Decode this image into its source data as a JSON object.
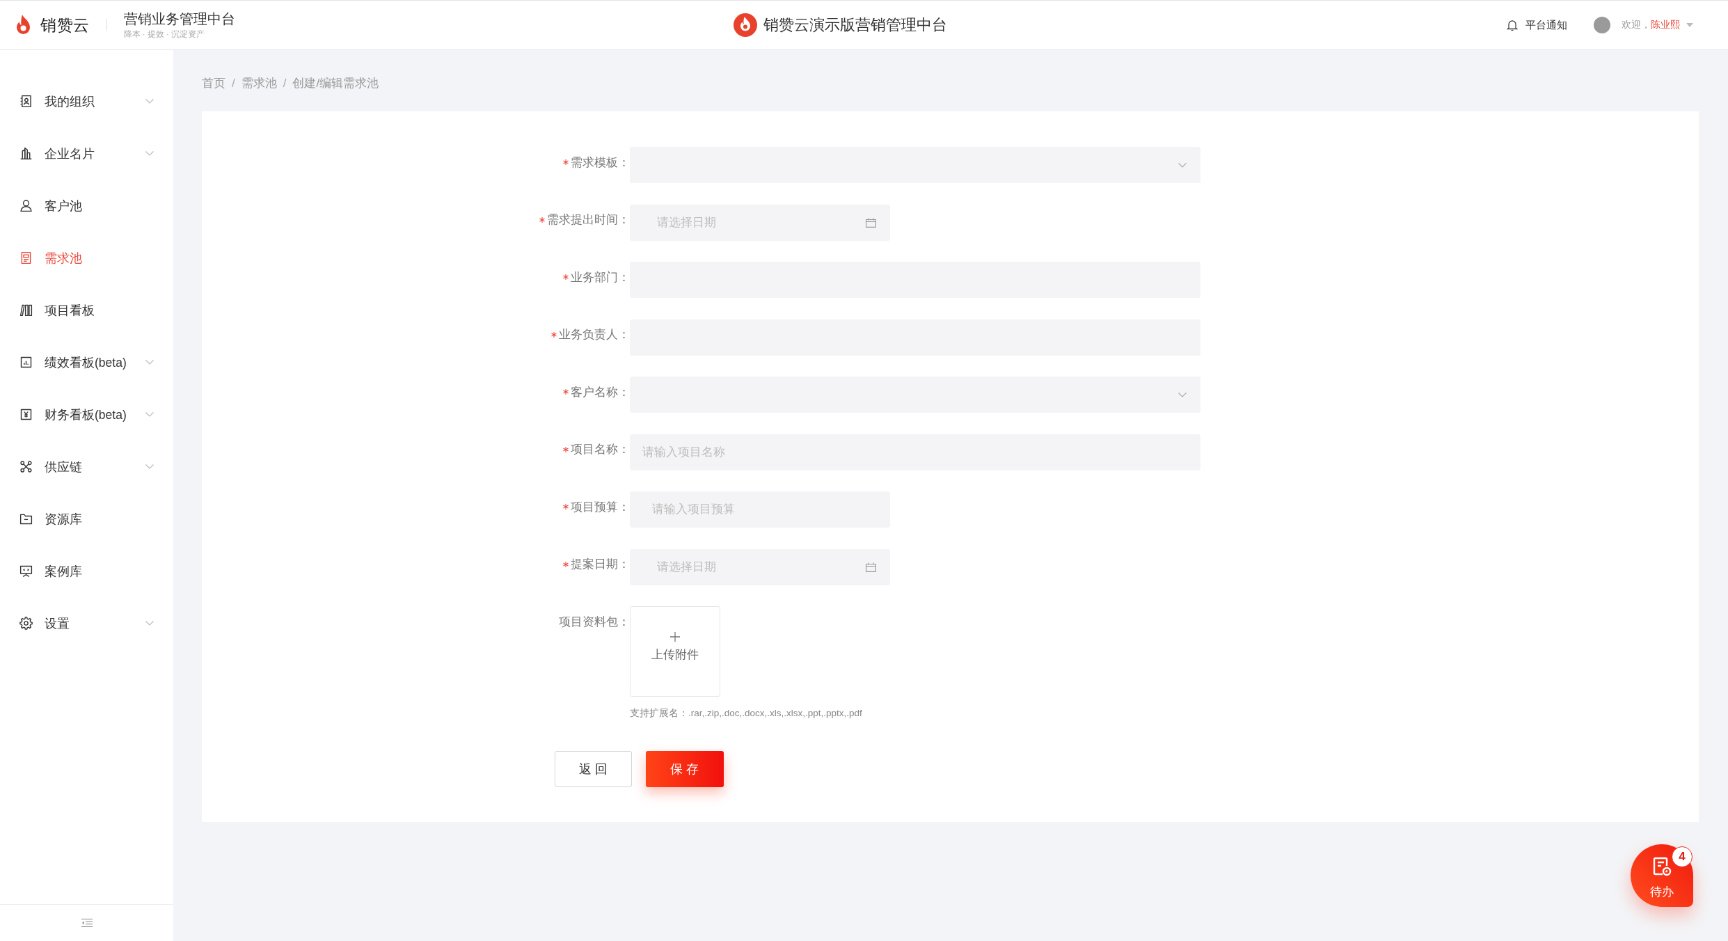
{
  "header": {
    "brand": "销赞云",
    "title": "营销业务管理中台",
    "slogan": "降本 · 提效 · 沉淀资产",
    "center_title": "销赞云演示版营销管理中台",
    "notice": "平台通知",
    "welcome": "欢迎，",
    "user_name": "陈业熙"
  },
  "sidebar": {
    "items": [
      {
        "label": "我的组织",
        "kind": "submenu",
        "selected": false
      },
      {
        "label": "企业名片",
        "kind": "submenu",
        "selected": false
      },
      {
        "label": "客户池",
        "kind": "link",
        "selected": false
      },
      {
        "label": "需求池",
        "kind": "link",
        "selected": true
      },
      {
        "label": "项目看板",
        "kind": "link",
        "selected": false
      },
      {
        "label": "绩效看板(beta)",
        "kind": "submenu",
        "selected": false
      },
      {
        "label": "财务看板(beta)",
        "kind": "submenu",
        "selected": false
      },
      {
        "label": "供应链",
        "kind": "submenu",
        "selected": false
      },
      {
        "label": "资源库",
        "kind": "link",
        "selected": false
      },
      {
        "label": "案例库",
        "kind": "link",
        "selected": false
      },
      {
        "label": "设置",
        "kind": "submenu",
        "selected": false
      }
    ]
  },
  "breadcrumb": {
    "separator": "/",
    "items": [
      "首页",
      "需求池",
      "创建/编辑需求池"
    ]
  },
  "form": {
    "fields": [
      {
        "label": "需求模板：",
        "required": true,
        "kind": "select"
      },
      {
        "label": "需求提出时间：",
        "required": true,
        "kind": "date",
        "placeholder": "请选择日期"
      },
      {
        "label": "业务部门：",
        "required": true,
        "kind": "text"
      },
      {
        "label": "业务负责人：",
        "required": true,
        "kind": "text"
      },
      {
        "label": "客户名称：",
        "required": true,
        "kind": "select"
      },
      {
        "label": "项目名称：",
        "required": true,
        "kind": "text",
        "placeholder": "请输入项目名称"
      },
      {
        "label": "项目预算：",
        "required": true,
        "kind": "number",
        "placeholder": "请输入项目预算"
      },
      {
        "label": "提案日期：",
        "required": true,
        "kind": "date",
        "placeholder": "请选择日期"
      },
      {
        "label": "项目资料包：",
        "required": false,
        "kind": "upload",
        "button": "上传附件",
        "hint": "支持扩展名：.rar,.zip,.doc,.docx,.xls,.xlsx,.ppt,.pptx,.pdf"
      }
    ],
    "buttons": [
      {
        "label": "返 回",
        "kind": "default"
      },
      {
        "label": "保 存",
        "kind": "primary"
      }
    ]
  },
  "todo": {
    "label": "待办",
    "count": "4"
  }
}
